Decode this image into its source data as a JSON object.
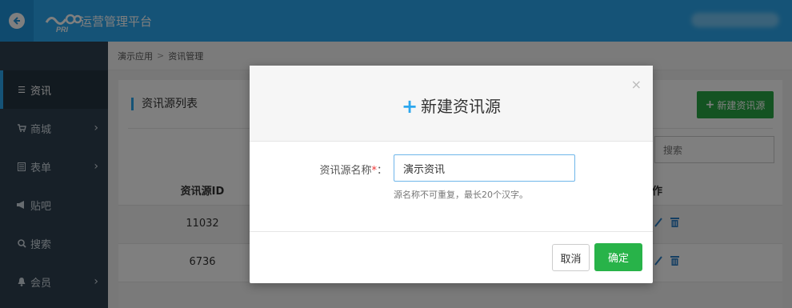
{
  "header": {
    "title": "运营管理平台",
    "back_icon": "back-arrow-icon",
    "logo_text": "PRI"
  },
  "sidebar": {
    "items": [
      {
        "label": "资讯",
        "icon": "list-icon",
        "active": true,
        "has_submenu": false
      },
      {
        "label": "商城",
        "icon": "cart-icon",
        "active": false,
        "has_submenu": true
      },
      {
        "label": "表单",
        "icon": "form-icon",
        "active": false,
        "has_submenu": true
      },
      {
        "label": "贴吧",
        "icon": "bullhorn-icon",
        "active": false,
        "has_submenu": false
      },
      {
        "label": "搜索",
        "icon": "search-icon",
        "active": false,
        "has_submenu": false
      },
      {
        "label": "会员",
        "icon": "bell-icon",
        "active": false,
        "has_submenu": true
      }
    ]
  },
  "breadcrumb": {
    "items": [
      "演示应用",
      "资讯管理"
    ],
    "separator": ">"
  },
  "panel": {
    "title": "资讯源列表",
    "new_button": "新建资讯源",
    "search_placeholder": "搜索",
    "columns": {
      "id": "资讯源ID",
      "ops": "作"
    },
    "rows": [
      {
        "id": "11032"
      },
      {
        "id": "6736"
      }
    ]
  },
  "modal": {
    "title": "新建资讯源",
    "close": "×",
    "field_label": "资讯源名称",
    "required_mark": "*",
    "colon": "：",
    "field_value": "演示资讯",
    "help_text": "源名称不可重复，最长20个汉字。",
    "cancel_label": "取消",
    "ok_label": "确定"
  },
  "colors": {
    "topbar": "#2ba7ee",
    "sidebar": "#2f4050",
    "primary_green": "#28a745",
    "accent_blue": "#2ba7ee"
  }
}
